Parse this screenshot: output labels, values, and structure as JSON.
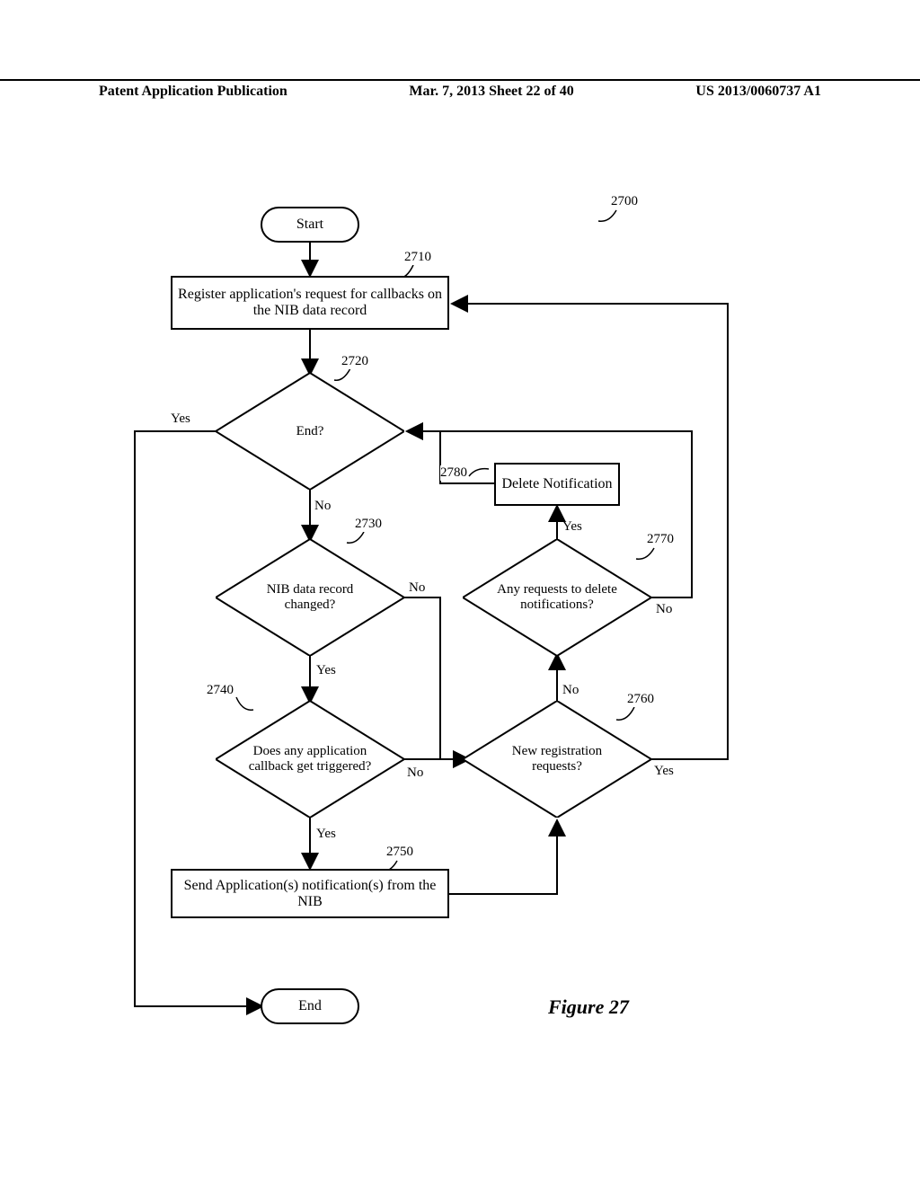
{
  "header": {
    "left": "Patent Application Publication",
    "center": "Mar. 7, 2013  Sheet 22 of 40",
    "right": "US 2013/0060737 A1"
  },
  "figure": {
    "ref_main": "2700",
    "title": "Figure 27",
    "nodes": {
      "start": "Start",
      "end": "End",
      "register": "Register application's request for callbacks on the NIB data record",
      "send": "Send Application(s) notification(s) from the NIB",
      "delete": "Delete Notification",
      "d_end": "End?",
      "d_nibchanged": "NIB data record changed?",
      "d_callback": "Does any application callback get triggered?",
      "d_newreg": "New registration requests?",
      "d_delreq": "Any requests to delete notifications?"
    },
    "refs": {
      "register": "2710",
      "d_end": "2720",
      "d_nibchanged": "2730",
      "d_callback": "2740",
      "send": "2750",
      "d_newreg": "2760",
      "d_delreq": "2770",
      "delete": "2780"
    },
    "edge_labels": {
      "yes": "Yes",
      "no": "No"
    }
  }
}
